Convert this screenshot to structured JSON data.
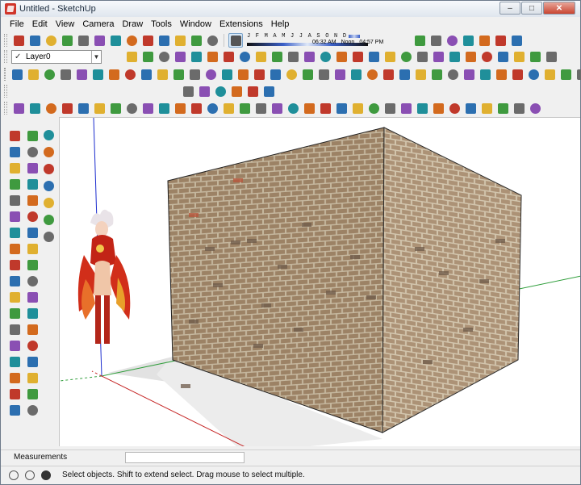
{
  "window": {
    "title": "Untitled - SketchUp",
    "minimize_glyph": "–",
    "maximize_glyph": "□",
    "close_glyph": "✕"
  },
  "menubar": {
    "items": [
      "File",
      "Edit",
      "View",
      "Camera",
      "Draw",
      "Tools",
      "Window",
      "Extensions",
      "Help"
    ]
  },
  "layers": {
    "check_glyph": "✓",
    "current_layer": "Layer0",
    "arrow_glyph": "▼"
  },
  "shadow_settings": {
    "months": "J F M A M J J A S O N D",
    "time_start": "06:32 AM",
    "time_noon": "Noon",
    "time_end": "04:57 PM"
  },
  "viewport": {
    "brick_base_color": "#a5896b",
    "brick_dark_color": "#6d5a4a",
    "brick_red_color": "#b8533a",
    "mortar_color": "#cfc0a6",
    "axis_red": "#c62828",
    "axis_green": "#2e9d3a",
    "axis_blue": "#1e2fcf"
  },
  "measurements": {
    "label": "Measurements",
    "value": ""
  },
  "status": {
    "message": "Select objects. Shift to extend select. Drag mouse to select multiple."
  },
  "toolbar_icons": {
    "colors": [
      "#c0392b",
      "#2c6fb0",
      "#e0b030",
      "#3f9a3f",
      "#6b6b6b",
      "#8a4fb3",
      "#1f8f9a",
      "#d36a1e"
    ]
  }
}
